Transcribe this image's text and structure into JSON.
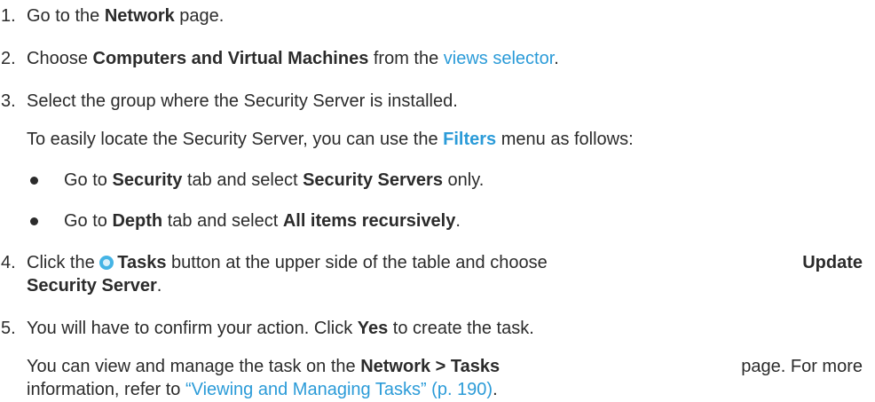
{
  "steps": [
    {
      "num": "1.",
      "a": "Go to the ",
      "b1": "Network",
      "c": " page."
    },
    {
      "num": "2.",
      "a": "Choose ",
      "b1": "Computers and Virtual Machines",
      "c": " from the ",
      "link": "views selector",
      "d": "."
    },
    {
      "num": "3.",
      "a": "Select the group where the Security Server is installed.",
      "note_a": "To easily locate the Security Server, you can use the ",
      "note_link": "Filters",
      "note_c": " menu as follows:",
      "bullets": [
        {
          "a": "Go to ",
          "b1": "Security",
          "c": " tab and select ",
          "b2": "Security Servers",
          "d": " only."
        },
        {
          "a": "Go to ",
          "b1": "Depth",
          "c": " tab and select ",
          "b2": "All items recursively",
          "d": "."
        }
      ]
    },
    {
      "num": "4.",
      "a": "Click the ",
      "b1": "Tasks",
      "c": " button at the upper side of the table and choose ",
      "b2": "Update",
      "b3": "Security Server",
      "d": "."
    },
    {
      "num": "5.",
      "a": "You will have to confirm your action. Click ",
      "b1": "Yes",
      "c": " to create the task.",
      "note_a": "You can view and manage the task on the ",
      "note_b": "Network > Tasks",
      "note_c": " page. For more",
      "note2_a": "information, refer to ",
      "note2_link": "“Viewing and Managing Tasks” (p. 190)",
      "note2_c": "."
    }
  ],
  "icons": {
    "task": "tasks-icon"
  }
}
